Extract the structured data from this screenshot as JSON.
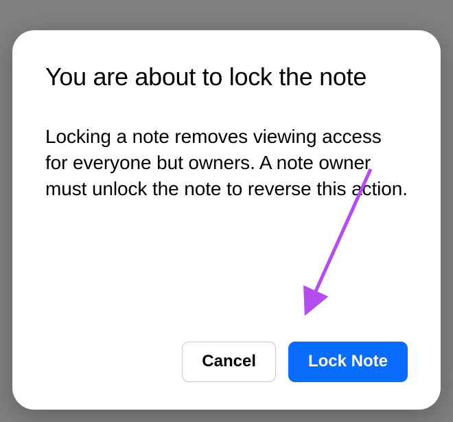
{
  "dialog": {
    "title": "You are about to lock the note",
    "body": "Locking a note removes viewing access for everyone but owners. A note owner must unlock the note to reverse this action.",
    "actions": {
      "cancel": "Cancel",
      "confirm": "Lock Note"
    }
  },
  "annotation": {
    "arrow_color": "#b44cf0"
  }
}
